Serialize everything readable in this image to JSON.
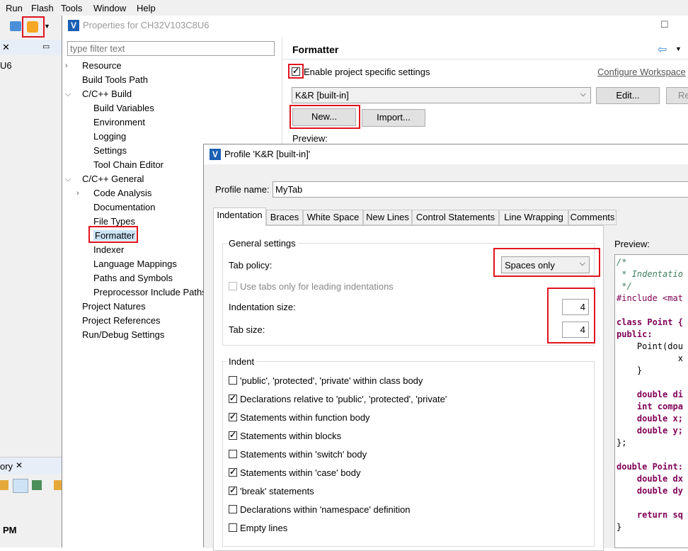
{
  "menubar": {
    "items": [
      "Run",
      "Flash",
      "Tools",
      "Window",
      "Help"
    ]
  },
  "left_panel": {
    "item_label": "U6",
    "history_tab": "ory",
    "time_text": "PM"
  },
  "properties": {
    "title": "Properties for CH32V103C8U6",
    "filter_placeholder": "type filter text",
    "tree": [
      {
        "label": "Resource",
        "expandable": true
      },
      {
        "label": "Build Tools Path"
      },
      {
        "label": "C/C++ Build",
        "expanded": true
      },
      {
        "label": "Build Variables"
      },
      {
        "label": "Environment"
      },
      {
        "label": "Logging"
      },
      {
        "label": "Settings"
      },
      {
        "label": "Tool Chain Editor"
      },
      {
        "label": "C/C++ General",
        "expanded": true
      },
      {
        "label": "Code Analysis",
        "expandable": true
      },
      {
        "label": "Documentation"
      },
      {
        "label": "File Types"
      },
      {
        "label": "Formatter",
        "selected": true
      },
      {
        "label": "Indexer"
      },
      {
        "label": "Language Mappings"
      },
      {
        "label": "Paths and Symbols"
      },
      {
        "label": "Preprocessor Include Paths"
      },
      {
        "label": "Project Natures"
      },
      {
        "label": "Project References"
      },
      {
        "label": "Run/Debug Settings"
      }
    ],
    "page_title": "Formatter",
    "enable_specific": "Enable project specific settings",
    "configure_link": "Configure Workspace",
    "profile_select": "K&R [built-in]",
    "edit_button": "Edit...",
    "remove_button": "Re",
    "new_button": "New...",
    "import_button": "Import...",
    "preview_label": "Preview:"
  },
  "profile_dialog": {
    "title": "Profile 'K&R [built-in]'",
    "profile_name_label": "Profile name:",
    "profile_name_value": "MyTab",
    "tabs": [
      "Indentation",
      "Braces",
      "White Space",
      "New Lines",
      "Control Statements",
      "Line Wrapping",
      "Comments"
    ],
    "general_settings_title": "General settings",
    "tab_policy_label": "Tab policy:",
    "tab_policy_value": "Spaces only",
    "use_tabs_leading": "Use tabs only for leading indentations",
    "indentation_size_label": "Indentation size:",
    "indentation_size_value": "4",
    "tab_size_label": "Tab size:",
    "tab_size_value": "4",
    "indent_title": "Indent",
    "indent_options": [
      {
        "label": "'public', 'protected', 'private' within class body",
        "checked": false
      },
      {
        "label": "Declarations relative to 'public', 'protected', 'private'",
        "checked": true
      },
      {
        "label": "Statements within function body",
        "checked": true
      },
      {
        "label": "Statements within blocks",
        "checked": true
      },
      {
        "label": "Statements within 'switch' body",
        "checked": false
      },
      {
        "label": "Statements within 'case' body",
        "checked": true
      },
      {
        "label": "'break' statements",
        "checked": true
      },
      {
        "label": "Declarations within 'namespace' definition",
        "checked": false
      },
      {
        "label": "Empty lines",
        "checked": false
      }
    ],
    "preview_label": "Preview:",
    "preview_lines": [
      {
        "text": "/*",
        "cls": "cm"
      },
      {
        "text": " * Indentatio",
        "cls": "cm"
      },
      {
        "text": " */",
        "cls": "cm"
      },
      {
        "text": "#include <mat",
        "cls": "pp"
      },
      {
        "text": "",
        "cls": ""
      },
      {
        "text": "class Point {",
        "cls": "kw"
      },
      {
        "text": "public:",
        "cls": "kw"
      },
      {
        "text": "    Point(dou",
        "cls": ""
      },
      {
        "text": "            x",
        "cls": ""
      },
      {
        "text": "    }",
        "cls": ""
      },
      {
        "text": "",
        "cls": ""
      },
      {
        "text": "    double di",
        "cls": "kw"
      },
      {
        "text": "    int compa",
        "cls": "kw"
      },
      {
        "text": "    double x;",
        "cls": "kw"
      },
      {
        "text": "    double y;",
        "cls": "kw"
      },
      {
        "text": "};",
        "cls": ""
      },
      {
        "text": "",
        "cls": ""
      },
      {
        "text": "double Point:",
        "cls": "kw"
      },
      {
        "text": "    double dx",
        "cls": "kw"
      },
      {
        "text": "    double dy",
        "cls": "kw"
      },
      {
        "text": "",
        "cls": ""
      },
      {
        "text": "    return sq",
        "cls": "kw"
      },
      {
        "text": "}",
        "cls": ""
      }
    ]
  }
}
